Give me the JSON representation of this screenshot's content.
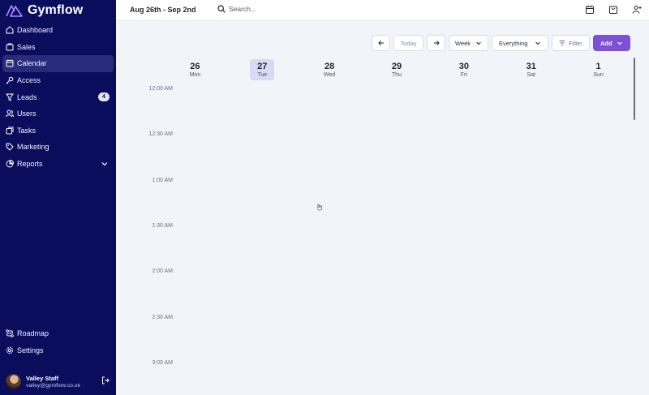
{
  "brand": {
    "name": "Gymflow"
  },
  "sidebar": {
    "items": [
      {
        "label": "Dashboard",
        "icon": "dashboard-icon"
      },
      {
        "label": "Sales",
        "icon": "sales-icon"
      },
      {
        "label": "Calendar",
        "icon": "calendar-icon"
      },
      {
        "label": "Access",
        "icon": "key-icon"
      },
      {
        "label": "Leads",
        "icon": "filter-funnel-icon",
        "badge": "4"
      },
      {
        "label": "Users",
        "icon": "users-icon"
      },
      {
        "label": "Tasks",
        "icon": "tasks-icon"
      },
      {
        "label": "Marketing",
        "icon": "tag-icon"
      },
      {
        "label": "Reports",
        "icon": "reports-icon"
      }
    ],
    "bottom": [
      {
        "label": "Roadmap",
        "icon": "roadmap-icon"
      },
      {
        "label": "Settings",
        "icon": "gear-icon"
      }
    ],
    "user": {
      "name": "Valley Staff",
      "email": "valley@gymflow.co.uk"
    }
  },
  "topbar": {
    "date_range": "Aug 26th - Sep 2nd",
    "search_placeholder": "Search..."
  },
  "toolbar": {
    "today": "Today",
    "view": "Week",
    "scope": "Everything",
    "filter": "Filter",
    "add": "Add"
  },
  "calendar": {
    "days": [
      {
        "num": "26",
        "name": "Mon"
      },
      {
        "num": "27",
        "name": "Tue",
        "today": true
      },
      {
        "num": "28",
        "name": "Wed"
      },
      {
        "num": "29",
        "name": "Thu"
      },
      {
        "num": "30",
        "name": "Fri"
      },
      {
        "num": "31",
        "name": "Sat"
      },
      {
        "num": "1",
        "name": "Sun"
      }
    ],
    "times": [
      "12:00 AM",
      "12:30 AM",
      "1:00 AM",
      "1:30 AM",
      "2:00 AM",
      "2:30 AM",
      "3:00 AM"
    ]
  },
  "colors": {
    "sidebar": "#0a0d5c",
    "accent": "#7b51d8",
    "today_bg": "#d8d9f4"
  }
}
